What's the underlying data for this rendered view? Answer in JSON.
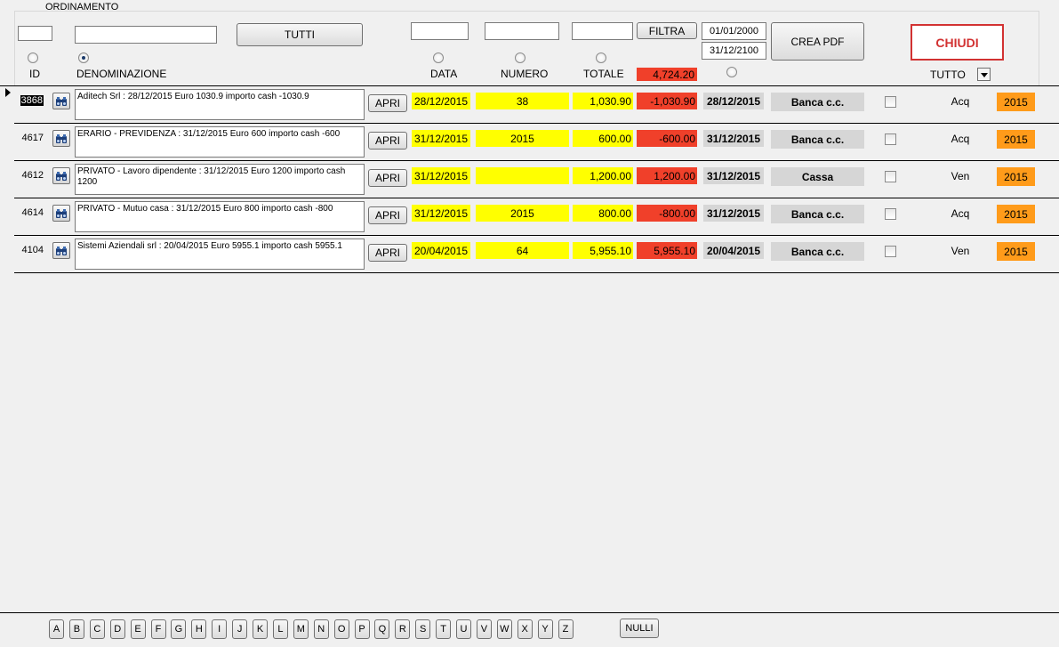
{
  "header": {
    "ordinamento_label": "ORDINAMENTO",
    "tutti_button": "TUTTI",
    "filtra_button": "FILTRA",
    "date_from": "01/01/2000",
    "date_to": "31/12/2100",
    "crea_pdf_button": "CREA PDF",
    "chiudi_button": "CHIUDI",
    "sort_labels": {
      "id": "ID",
      "denominazione": "DENOMINAZIONE",
      "data": "DATA",
      "numero": "NUMERO",
      "totale": "TOTALE"
    },
    "total_value": "4,724.20",
    "tutto_label": "TUTTO"
  },
  "rows": [
    {
      "id": "3868",
      "desc": "Aditech Srl : 28/12/2015 Euro 1030.9 importo cash -1030.9",
      "apri": "APRI",
      "data": "28/12/2015",
      "numero": "38",
      "totale": "1,030.90",
      "importo": "-1,030.90",
      "data_pag": "28/12/2015",
      "conto": "Banca c.c.",
      "tipo": "Acq",
      "anno": "2015"
    },
    {
      "id": "4617",
      "desc": "ERARIO - PREVIDENZA : 31/12/2015 Euro 600 importo cash -600",
      "apri": "APRI",
      "data": "31/12/2015",
      "numero": "2015",
      "totale": "600.00",
      "importo": "-600.00",
      "data_pag": "31/12/2015",
      "conto": "Banca c.c.",
      "tipo": "Acq",
      "anno": "2015"
    },
    {
      "id": "4612",
      "desc": "PRIVATO - Lavoro dipendente : 31/12/2015 Euro 1200 importo cash 1200",
      "apri": "APRI",
      "data": "31/12/2015",
      "numero": "",
      "totale": "1,200.00",
      "importo": "1,200.00",
      "data_pag": "31/12/2015",
      "conto": "Cassa",
      "tipo": "Ven",
      "anno": "2015"
    },
    {
      "id": "4614",
      "desc": "PRIVATO - Mutuo casa : 31/12/2015 Euro 800 importo cash -800",
      "apri": "APRI",
      "data": "31/12/2015",
      "numero": "2015",
      "totale": "800.00",
      "importo": "-800.00",
      "data_pag": "31/12/2015",
      "conto": "Banca c.c.",
      "tipo": "Acq",
      "anno": "2015"
    },
    {
      "id": "4104",
      "desc": "Sistemi Aziendali srl : 20/04/2015 Euro 5955.1 importo cash 5955.1",
      "apri": "APRI",
      "data": "20/04/2015",
      "numero": "64",
      "totale": "5,955.10",
      "importo": "5,955.10",
      "data_pag": "20/04/2015",
      "conto": "Banca c.c.",
      "tipo": "Ven",
      "anno": "2015"
    }
  ],
  "footer": {
    "letters": [
      "A",
      "B",
      "C",
      "D",
      "E",
      "F",
      "G",
      "H",
      "I",
      "J",
      "K",
      "L",
      "M",
      "N",
      "O",
      "P",
      "Q",
      "R",
      "S",
      "T",
      "U",
      "V",
      "W",
      "X",
      "Y",
      "Z"
    ],
    "nulli_button": "NULLI"
  },
  "colors": {
    "yellow": "#ffff00",
    "red": "#f0402a",
    "orange": "#ff9b1a",
    "grey": "#d6d6d6",
    "chiudi": "#d23232"
  },
  "icons": {
    "row_open": "binoculars-icon",
    "record_pointer": "record-selector-icon",
    "dropdown": "chevron-down-icon"
  }
}
